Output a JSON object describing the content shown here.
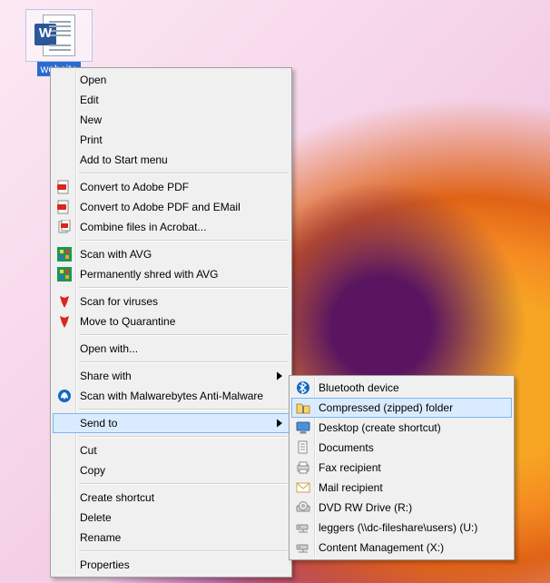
{
  "desktop": {
    "file": {
      "label": "website"
    }
  },
  "contextMenu": {
    "items": [
      {
        "label": "Open"
      },
      {
        "label": "Edit"
      },
      {
        "label": "New"
      },
      {
        "label": "Print"
      },
      {
        "label": "Add to Start menu"
      },
      {
        "label": "Convert to Adobe PDF"
      },
      {
        "label": "Convert to Adobe PDF and EMail"
      },
      {
        "label": "Combine files in Acrobat..."
      },
      {
        "label": "Scan with AVG"
      },
      {
        "label": "Permanently shred with AVG"
      },
      {
        "label": "Scan for viruses"
      },
      {
        "label": "Move to Quarantine"
      },
      {
        "label": "Open with..."
      },
      {
        "label": "Share with"
      },
      {
        "label": "Scan with Malwarebytes Anti-Malware"
      },
      {
        "label": "Send to"
      },
      {
        "label": "Cut"
      },
      {
        "label": "Copy"
      },
      {
        "label": "Create shortcut"
      },
      {
        "label": "Delete"
      },
      {
        "label": "Rename"
      },
      {
        "label": "Properties"
      }
    ]
  },
  "sendTo": {
    "items": [
      {
        "label": "Bluetooth device"
      },
      {
        "label": "Compressed (zipped) folder"
      },
      {
        "label": "Desktop (create shortcut)"
      },
      {
        "label": "Documents"
      },
      {
        "label": "Fax recipient"
      },
      {
        "label": "Mail recipient"
      },
      {
        "label": "DVD RW Drive (R:)"
      },
      {
        "label": "leggers (\\\\dc-fileshare\\users) (U:)"
      },
      {
        "label": "Content Management (X:)"
      }
    ]
  }
}
